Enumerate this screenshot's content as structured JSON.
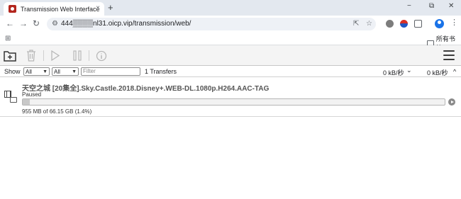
{
  "browser": {
    "tab": {
      "title": "Transmission Web Interface",
      "close": "×"
    },
    "new_tab": "+",
    "window_controls": {
      "minimize": "−",
      "restore": "⧉",
      "close": "✕"
    },
    "nav": {
      "back": "←",
      "forward": "→",
      "reload": "↻"
    },
    "url": "444▒▒▒▒nl31.oicp.vip/transmission/web/",
    "bookmarks_folder": "所有书签"
  },
  "app": {
    "toolbar": {
      "icons": [
        "open-torrent-icon",
        "remove-icon",
        "start-icon",
        "pause-icon",
        "inspector-icon",
        "menu-icon"
      ]
    },
    "filter": {
      "show_label": "Show",
      "state_value": "All",
      "tracker_value": "All",
      "search_placeholder": "Filter",
      "transfers_count": "1 Transfers",
      "download_speed": "0 kB/秒",
      "upload_speed": "0 kB/秒",
      "down_arrow": "⌄",
      "up_arrow": "^"
    },
    "torrents": [
      {
        "name": "天空之城 [20集全].Sky.Castle.2018.Disney+.WEB-DL.1080p.H264.AAC-TAG",
        "status": "Paused",
        "progress": 0.014,
        "size_text": "955 MB of 66.15 GB (1.4%)"
      }
    ]
  },
  "colors": {
    "tabstrip": "#e3e8ef",
    "toolbar_bg": "#f4f4f4",
    "progress_fill": "#c8c8c8"
  }
}
